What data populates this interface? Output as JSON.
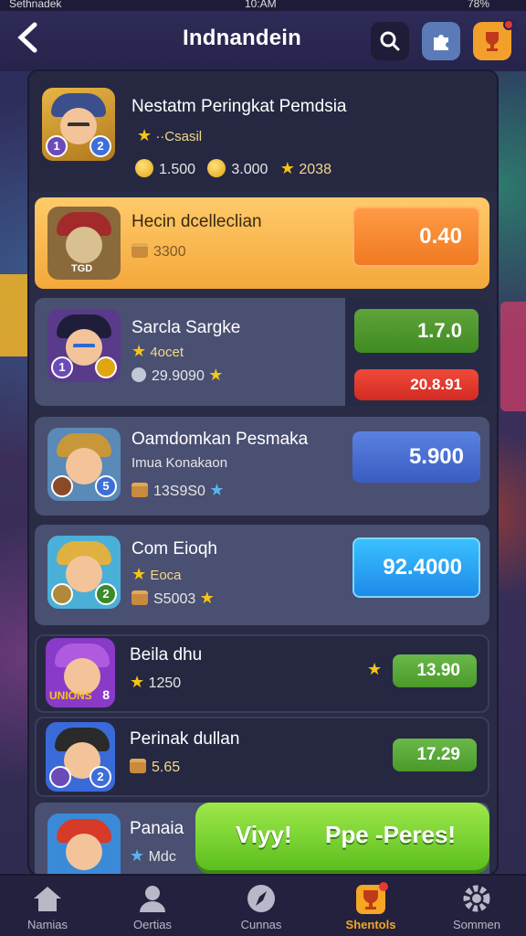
{
  "status_bar": {
    "carrier": "Sethnadek",
    "time": "10:AM",
    "battery": "78%"
  },
  "header": {
    "title": "Indnandein"
  },
  "top_player": {
    "title": "Nestatm Peringkat Pemdsia",
    "rank_label": "··Csasil",
    "badge_left": "1",
    "badge_right": "2",
    "coins_1": "1.500",
    "coins_2": "3.000",
    "stars": "2038"
  },
  "rows": [
    {
      "name": "Hecin dcelleclian",
      "meta": "3300",
      "value": "0.40",
      "badge": "",
      "avatar_label": "TGD"
    },
    {
      "name": "Sarcla Sargke",
      "sub": "4ocet",
      "meta": "29.9090",
      "value": "1.7.0",
      "value2": "20.8.91",
      "badge_left": "1",
      "badge_right": ""
    },
    {
      "name": "Oamdomkan Pesmaka",
      "sub": "Imua Konakaon",
      "meta": "13S9S0",
      "value": "5.900",
      "badge": "5"
    },
    {
      "name": "Com Eioqh",
      "sub": "Eoca",
      "meta": "S5003",
      "value": "92.4000",
      "badge": "2"
    },
    {
      "name": "Beila dhu",
      "meta": "1250",
      "value": "13.90",
      "avatar_label": "UNIONS",
      "badge": "8"
    },
    {
      "name": "Perinak dullan",
      "meta": "5.65",
      "value": "17.29",
      "badge": "2"
    },
    {
      "name": "Panaia",
      "meta": "Mdc"
    }
  ],
  "cta": {
    "left": "Viyy!",
    "right": "Ppe -Peres!"
  },
  "nav": [
    {
      "label": "Namias"
    },
    {
      "label": "Oertias"
    },
    {
      "label": "Cunnas"
    },
    {
      "label": "Shentols"
    },
    {
      "label": "Sommen"
    }
  ]
}
